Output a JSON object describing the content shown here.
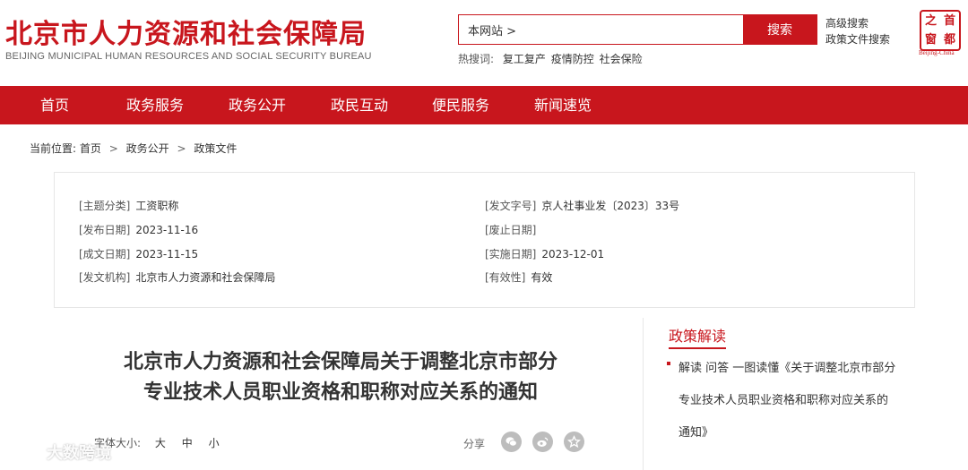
{
  "header": {
    "logo_cn": "北京市人力资源和社会保障局",
    "logo_en": "BEIJING MUNICIPAL HUMAN RESOURCES AND SOCIAL SECURITY BUREAU",
    "search_value": "本网站 >",
    "search_button": "搜索",
    "hot_label": "热搜词:",
    "hot_words": [
      "复工复产",
      "疫情防控",
      "社会保险"
    ],
    "advanced_search": "高级搜索",
    "policy_search": "政策文件搜索",
    "seal_chars": [
      "首",
      "都",
      "之",
      "窗"
    ],
    "seal_en": "Beijing-China"
  },
  "nav": {
    "items": [
      "首页",
      "政务服务",
      "政务公开",
      "政民互动",
      "便民服务",
      "新闻速览"
    ]
  },
  "breadcrumb": {
    "prefix": "当前位置:",
    "items": [
      "首页",
      "政务公开",
      "政策文件"
    ],
    "separator": ">"
  },
  "info": {
    "topic_key": "[主题分类]",
    "topic_val": "工资职称",
    "doc_no_key": "[发文字号]",
    "doc_no_val": "京人社事业发〔2023〕33号",
    "publish_key": "[发布日期]",
    "publish_val": "2023-11-16",
    "abolish_key": "[废止日期]",
    "abolish_val": "",
    "written_key": "[成文日期]",
    "written_val": "2023-11-15",
    "effective_key": "[实施日期]",
    "effective_val": "2023-12-01",
    "issuer_key": "[发文机构]",
    "issuer_val": "北京市人力资源和社会保障局",
    "validity_key": "[有效性]",
    "validity_val": "有效"
  },
  "document": {
    "title_line1": "北京市人力资源和社会保障局关于调整北京市部分",
    "title_line2": "专业技术人员职业资格和职称对应关系的通知"
  },
  "tools": {
    "font_size_label": "字体大小:",
    "size_large": "大",
    "size_medium": "中",
    "size_small": "小",
    "share_label": "分享"
  },
  "sidebar": {
    "title": "政策解读",
    "link": "解读 问答 一图读懂《关于调整北京市部分专业技术人员职业资格和职称对应关系的通知》"
  },
  "watermark": {
    "text": "大数跨境"
  },
  "colors": {
    "brand_red": "#c8161d",
    "text": "#333333",
    "border": "#e6e6e6",
    "share_icon_bg": "#bdbdbd"
  },
  "icons": [
    "wechat-icon",
    "weibo-icon",
    "favorite-star-icon",
    "watermark-logo-icon"
  ]
}
